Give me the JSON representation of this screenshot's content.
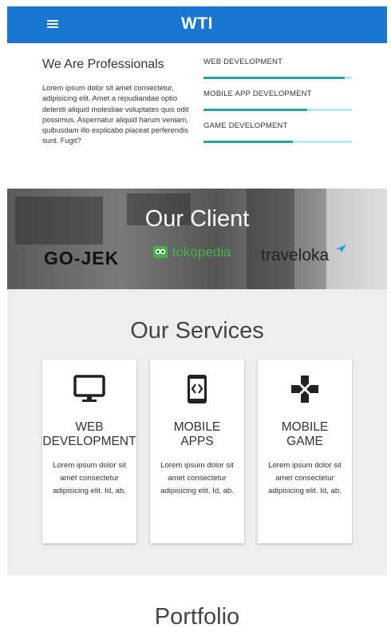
{
  "header": {
    "brand": "WTI",
    "menu_icon": "menu-icon"
  },
  "about": {
    "title": "We Are Professionals",
    "text": "Lorem ipsum dolor sit amet consectetur, adipisicing elit. Amet a repudiandae optio deleniti aliquid molestiae voluptates quis odit possimus. Aspernatur aliquid harum veniam, quibusdam illo explicabo placeat perferendis sunt. Fugit?",
    "skills": [
      {
        "label": "WEB DEVELOPMENT",
        "level": 0.95
      },
      {
        "label": "MOBILE APP DEVELOPMENT",
        "level": 0.7
      },
      {
        "label": "GAME DEVELOPMENT",
        "level": 0.6
      }
    ]
  },
  "clients": {
    "title": "Our Client",
    "logos": [
      "GO-JEK",
      "tokopedia",
      "traveloka"
    ]
  },
  "services": {
    "title": "Our Services",
    "cards": [
      {
        "icon": "monitor-icon",
        "title": "WEB\nDEVELOPMENT",
        "text": "Lorem ipsum dolor sit amet consectetur adipisicing elit. Id, ab."
      },
      {
        "icon": "mobile-code-icon",
        "title": "MOBILE\nAPPS",
        "text": "Lorem ipsum dolor sit amet consectetur adipisicing elit. Id, ab."
      },
      {
        "icon": "gamepad-icon",
        "title": "MOBILE\nGAME",
        "text": "Lorem ipsum dolor sit amet consectetur adipisicing elit. Id, ab."
      }
    ]
  },
  "portfolio": {
    "title": "Portfolio"
  },
  "colors": {
    "primary": "#1976d2",
    "progress": "#26a69a",
    "progress_track": "#b2ebf2",
    "services_bg": "#eeeeee"
  }
}
